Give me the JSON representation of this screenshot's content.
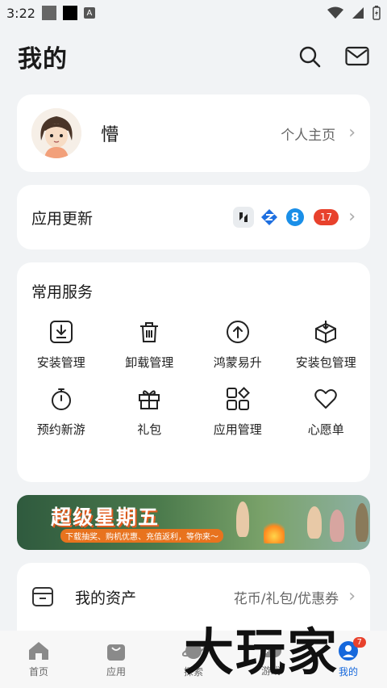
{
  "status": {
    "time": "3:22"
  },
  "header": {
    "title": "我的",
    "search_icon": "search-icon",
    "mail_icon": "mail-icon"
  },
  "profile": {
    "name": "懵",
    "link": "个人主页"
  },
  "update": {
    "label": "应用更新",
    "badge": "17",
    "app_icons": [
      "huawei-app-icon",
      "blue-z-app-icon",
      "number-8-app-icon"
    ]
  },
  "services": {
    "title": "常用服务",
    "items": [
      {
        "label": "安装管理",
        "icon": "download-icon"
      },
      {
        "label": "卸载管理",
        "icon": "trash-icon"
      },
      {
        "label": "鸿蒙易升",
        "icon": "upgrade-icon"
      },
      {
        "label": "安装包管理",
        "icon": "package-icon"
      },
      {
        "label": "预约新游",
        "icon": "stopwatch-icon"
      },
      {
        "label": "礼包",
        "icon": "gift-icon"
      },
      {
        "label": "应用管理",
        "icon": "apps-icon"
      },
      {
        "label": "心愿单",
        "icon": "heart-icon"
      }
    ]
  },
  "banner": {
    "title": "超级星期五",
    "subtitle": "下载抽奖、购机优惠、充值返利，等你来～"
  },
  "assets": {
    "label": "我的资产",
    "detail": "花币/礼包/优惠券"
  },
  "nav": {
    "items": [
      {
        "label": "首页",
        "icon": "home-icon",
        "active": false
      },
      {
        "label": "应用",
        "icon": "shopping-bag-icon",
        "active": false
      },
      {
        "label": "探索",
        "icon": "planet-icon",
        "active": false
      },
      {
        "label": "游戏",
        "icon": "game-icon",
        "active": false
      },
      {
        "label": "我的",
        "icon": "profile-icon",
        "active": true,
        "badge": "7"
      }
    ]
  },
  "watermark": {
    "text": "大玩家"
  },
  "colors": {
    "accent": "#1668dc",
    "badge": "#e8412c",
    "background": "#f1f3f5"
  }
}
